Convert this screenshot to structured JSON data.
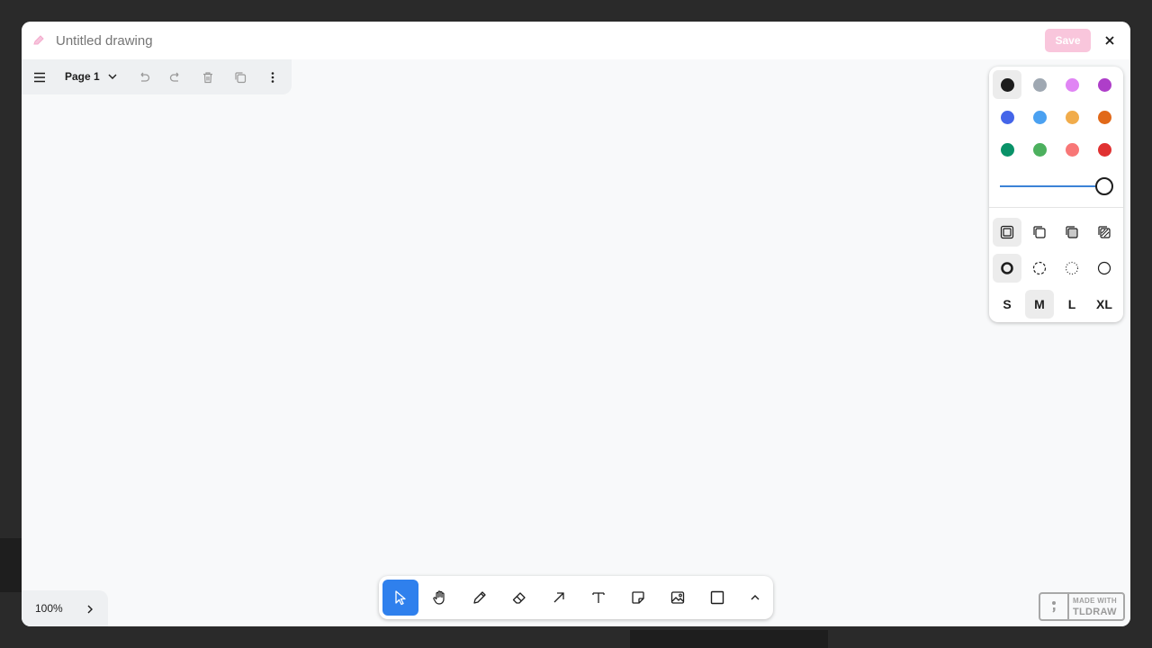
{
  "header": {
    "title_placeholder": "Untitled drawing",
    "title_value": "",
    "save_label": "Save",
    "close_icon": "close-icon",
    "edit_icon": "pencil-icon"
  },
  "menu_panel": {
    "page_label": "Page 1",
    "icons": [
      "hamburger-menu-icon",
      "chevron-down-icon",
      "undo-icon",
      "redo-icon",
      "trash-icon",
      "duplicate-icon",
      "more-vertical-icon"
    ]
  },
  "style_panel": {
    "colors": [
      {
        "name": "black",
        "hex": "#1d1d1d",
        "selected": true
      },
      {
        "name": "grey",
        "hex": "#9fa8b2",
        "selected": false
      },
      {
        "name": "light-violet",
        "hex": "#e085f4",
        "selected": false
      },
      {
        "name": "violet",
        "hex": "#ae3ec9",
        "selected": false
      },
      {
        "name": "blue",
        "hex": "#4465e9",
        "selected": false
      },
      {
        "name": "light-blue",
        "hex": "#4ba1f1",
        "selected": false
      },
      {
        "name": "yellow",
        "hex": "#f1ac4b",
        "selected": false
      },
      {
        "name": "orange",
        "hex": "#e16919",
        "selected": false
      },
      {
        "name": "green",
        "hex": "#099268",
        "selected": false
      },
      {
        "name": "light-green",
        "hex": "#4cb05e",
        "selected": false
      },
      {
        "name": "light-red",
        "hex": "#f87777",
        "selected": false
      },
      {
        "name": "red",
        "hex": "#e03131",
        "selected": false
      }
    ],
    "opacity": 1.0,
    "fill_options": [
      "fill-none-icon",
      "fill-semi-icon",
      "fill-solid-icon",
      "fill-pattern-icon"
    ],
    "fill_selected": 0,
    "dash_options": [
      "dash-draw-icon",
      "dash-dashed-icon",
      "dash-dotted-icon",
      "dash-solid-icon"
    ],
    "dash_selected": 0,
    "sizes": [
      "S",
      "M",
      "L",
      "XL"
    ],
    "size_selected": 1
  },
  "zoom": {
    "label": "100%",
    "icon": "chevron-right-icon"
  },
  "toolbar": {
    "tools": [
      {
        "name": "select-tool",
        "icon": "cursor-icon",
        "active": true
      },
      {
        "name": "hand-tool",
        "icon": "hand-icon",
        "active": false
      },
      {
        "name": "draw-tool",
        "icon": "pencil-icon",
        "active": false
      },
      {
        "name": "eraser-tool",
        "icon": "eraser-icon",
        "active": false
      },
      {
        "name": "arrow-tool",
        "icon": "arrow-icon",
        "active": false
      },
      {
        "name": "text-tool",
        "icon": "text-icon",
        "active": false
      },
      {
        "name": "note-tool",
        "icon": "sticky-note-icon",
        "active": false
      },
      {
        "name": "image-tool",
        "icon": "image-icon",
        "active": false
      },
      {
        "name": "rectangle-tool",
        "icon": "rectangle-icon",
        "active": false
      },
      {
        "name": "more-tools",
        "icon": "chevron-up-icon",
        "active": false
      }
    ]
  },
  "watermark": {
    "line1": "MADE WITH",
    "line2": "TLDRAW",
    "icon": "tldraw-logo-icon"
  }
}
